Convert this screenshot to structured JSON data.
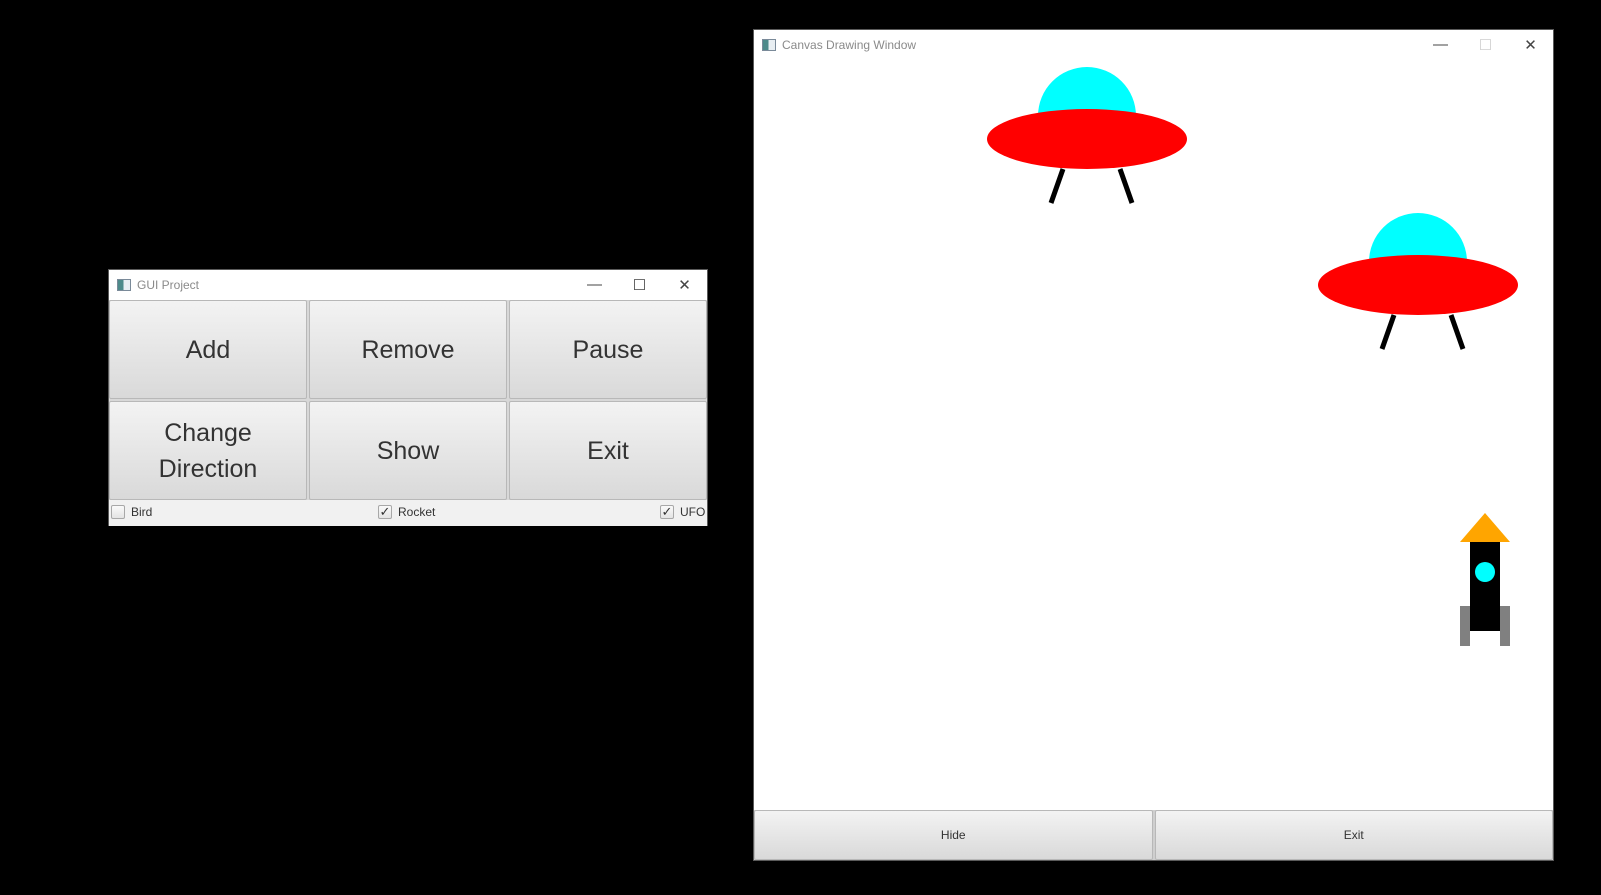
{
  "gui_window": {
    "title": "GUI Project",
    "controls": {
      "minimize": "—",
      "maximize": "☐",
      "close": "✕"
    },
    "buttons": [
      {
        "label": "Add"
      },
      {
        "label": "Remove"
      },
      {
        "label": "Pause"
      },
      {
        "label": "Change Direction"
      },
      {
        "label": "Show"
      },
      {
        "label": "Exit"
      }
    ],
    "checkboxes": [
      {
        "label": "Bird",
        "checked": false
      },
      {
        "label": "Rocket",
        "checked": true
      },
      {
        "label": "UFO",
        "checked": true
      }
    ]
  },
  "canvas_window": {
    "title": "Canvas Drawing Window",
    "controls": {
      "minimize": "—",
      "maximize": "☐",
      "close": "✕"
    },
    "buttons": {
      "hide": "Hide",
      "exit": "Exit"
    },
    "objects": [
      "ufo",
      "ufo",
      "rocket"
    ],
    "colors": {
      "ufo_dome": "#00ffff",
      "ufo_body": "#ff0000",
      "ufo_legs": "#000000",
      "rocket_nose": "#ffa500",
      "rocket_body": "#000000",
      "rocket_window": "#00ffff",
      "rocket_fins": "#808080"
    }
  }
}
